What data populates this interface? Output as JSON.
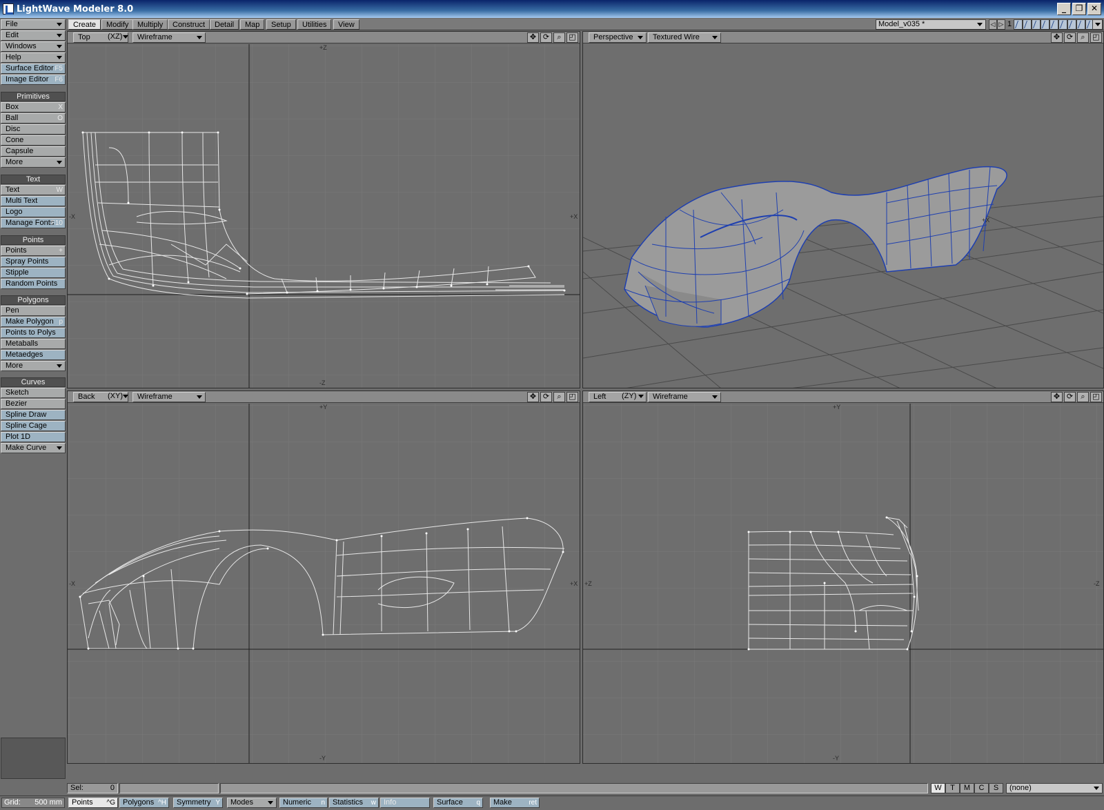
{
  "window": {
    "title": "LightWave Modeler 8.0"
  },
  "sidebar": {
    "menus": [
      {
        "label": "File"
      },
      {
        "label": "Edit"
      },
      {
        "label": "Windows"
      },
      {
        "label": "Help"
      }
    ],
    "editors": [
      {
        "label": "Surface Editor",
        "key": "F5"
      },
      {
        "label": "Image Editor",
        "key": "F6"
      }
    ],
    "sections": {
      "primitives": {
        "title": "Primitives",
        "items": [
          {
            "label": "Box",
            "key": "X"
          },
          {
            "label": "Ball",
            "key": "O"
          },
          {
            "label": "Disc",
            "key": ""
          },
          {
            "label": "Cone",
            "key": ""
          },
          {
            "label": "Capsule",
            "key": ""
          },
          {
            "label": "More",
            "key": ""
          }
        ]
      },
      "text": {
        "title": "Text",
        "items": [
          {
            "label": "Text",
            "key": "W"
          },
          {
            "label": "Multi Text",
            "key": ""
          },
          {
            "label": "Logo",
            "key": ""
          },
          {
            "label": "Manage Fonts",
            "key": "F10"
          }
        ]
      },
      "points": {
        "title": "Points",
        "items": [
          {
            "label": "Points",
            "key": "+"
          },
          {
            "label": "Spray Points",
            "key": ""
          },
          {
            "label": "Stipple",
            "key": ""
          },
          {
            "label": "Random Points",
            "key": ""
          }
        ]
      },
      "polygons": {
        "title": "Polygons",
        "items": [
          {
            "label": "Pen",
            "key": ""
          },
          {
            "label": "Make Polygon",
            "key": "p"
          },
          {
            "label": "Points to Polys",
            "key": ""
          },
          {
            "label": "Metaballs",
            "key": ""
          },
          {
            "label": "Metaedges",
            "key": ""
          },
          {
            "label": "More",
            "key": ""
          }
        ]
      },
      "curves": {
        "title": "Curves",
        "items": [
          {
            "label": "Sketch",
            "key": ""
          },
          {
            "label": "Bezier",
            "key": ""
          },
          {
            "label": "Spline Draw",
            "key": ""
          },
          {
            "label": "Spline Cage",
            "key": ""
          },
          {
            "label": "Plot 1D",
            "key": ""
          },
          {
            "label": "Make Curve",
            "key": ""
          }
        ]
      }
    }
  },
  "tabs": [
    "Create",
    "Modify",
    "Multiply",
    "Construct",
    "Detail",
    "Map",
    "Setup",
    "Utilities",
    "View"
  ],
  "active_tab": "Create",
  "model": {
    "name": "Model_v035 *",
    "layer": "1"
  },
  "viewports": {
    "top": {
      "view": "Top",
      "axes": "(XZ)",
      "mode": "Wireframe",
      "labels": {
        "t": "+Z",
        "b": "-Z",
        "l": "-X",
        "r": "+X"
      }
    },
    "perspective": {
      "view": "Perspective",
      "mode": "Textured Wire",
      "label": "+X"
    },
    "back": {
      "view": "Back",
      "axes": "(XY)",
      "mode": "Wireframe",
      "labels": {
        "t": "+Y",
        "b": "-Y",
        "l": "-X",
        "r": "+X"
      }
    },
    "left": {
      "view": "Left",
      "axes": "(ZY)",
      "mode": "Wireframe",
      "labels": {
        "t": "+Y",
        "b": "-Y",
        "l": "+Z",
        "r": "-Z"
      }
    }
  },
  "status": {
    "sel_label": "Sel:",
    "sel_value": "0",
    "wtmcs": [
      "W",
      "T",
      "M",
      "C",
      "S"
    ],
    "surface": "(none)"
  },
  "bottombar": {
    "grid_label": "Grid:",
    "grid_value": "500 mm",
    "buttons": [
      {
        "label": "Points",
        "key": "^G"
      },
      {
        "label": "Polygons",
        "key": "^H"
      },
      {
        "label": "Symmetry",
        "key": "Y"
      },
      {
        "label": "Modes",
        "key": ""
      },
      {
        "label": "Numeric",
        "key": "n"
      },
      {
        "label": "Statistics",
        "key": "w"
      },
      {
        "label": "Info",
        "key": ""
      },
      {
        "label": "Surface",
        "key": "q"
      },
      {
        "label": "Make",
        "key": "ret"
      }
    ]
  },
  "colors": {
    "wire": "#e8e8e8",
    "mesh_blue": "#1e3fb0",
    "viewport_bg": "#6e6e6e"
  }
}
